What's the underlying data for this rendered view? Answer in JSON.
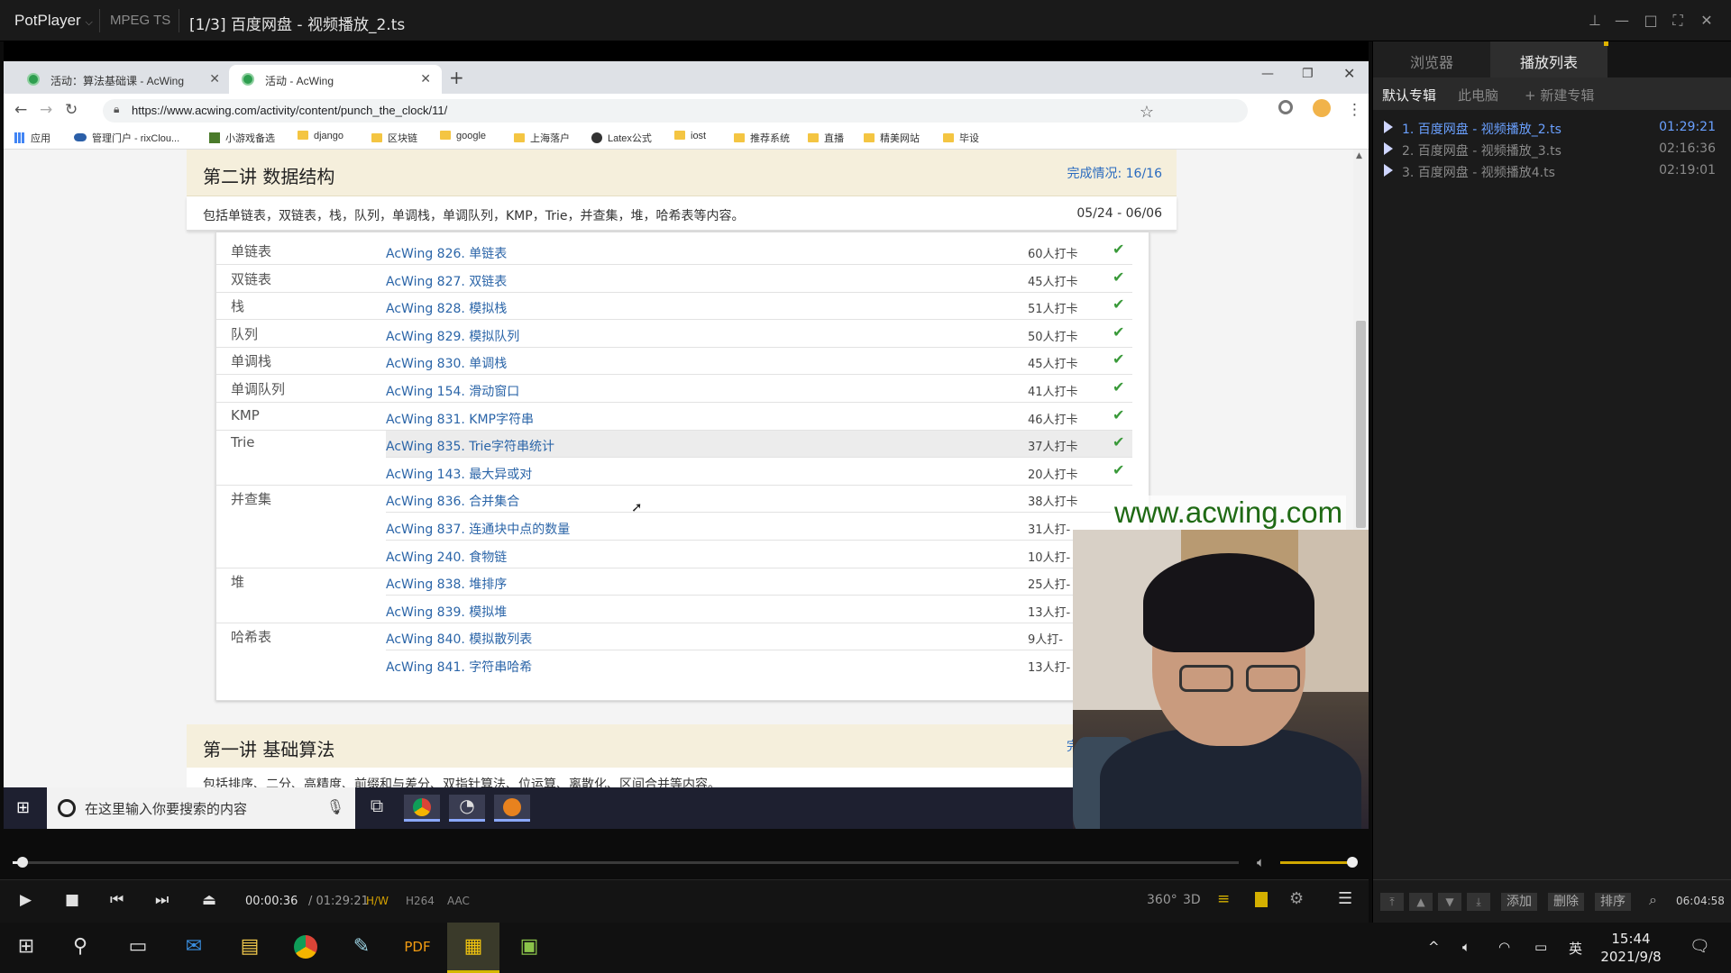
{
  "potplayer": {
    "brand": "PotPlayer",
    "format": "MPEG TS",
    "file_title": "[1/3] 百度网盘 - 视频播放_2.ts"
  },
  "chrome": {
    "tabs": [
      {
        "label": "活动：算法基础课 - AcWing",
        "active": false
      },
      {
        "label": "活动 - AcWing",
        "active": true
      }
    ],
    "new_tab": "+",
    "url": "https://www.acwing.com/activity/content/punch_the_clock/11/",
    "bookmarks": [
      {
        "label": "应用",
        "icon": "apps-icon"
      },
      {
        "label": "管理门户 - rixClou...",
        "icon": "cloud-icon"
      },
      {
        "label": "小游戏备选",
        "icon": "grid-icon"
      },
      {
        "label": "django",
        "icon": "folder-icon"
      },
      {
        "label": "区块链",
        "icon": "folder-icon"
      },
      {
        "label": "google",
        "icon": "folder-icon"
      },
      {
        "label": "上海落户",
        "icon": "folder-icon"
      },
      {
        "label": "Latex公式",
        "icon": "globe-icon"
      },
      {
        "label": "iost",
        "icon": "folder-icon"
      },
      {
        "label": "推荐系统",
        "icon": "folder-icon"
      },
      {
        "label": "直播",
        "icon": "folder-icon"
      },
      {
        "label": "精美网站",
        "icon": "folder-icon"
      },
      {
        "label": "毕设",
        "icon": "folder-icon"
      }
    ]
  },
  "course": {
    "section2": {
      "title": "第二讲 数据结构",
      "progress_label": "完成情况:  16/16",
      "description": "包括单链表，双链表，栈，队列，单调栈，单调队列，KMP，Trie，并查集，堆，哈希表等内容。",
      "dates": "05/24 - 06/06",
      "rows": [
        {
          "category": "单链表",
          "problem": "AcWing 826. 单链表",
          "count": "60人打卡",
          "done": true
        },
        {
          "category": "双链表",
          "problem": "AcWing 827. 双链表",
          "count": "45人打卡",
          "done": true
        },
        {
          "category": "栈",
          "problem": "AcWing 828. 模拟栈",
          "count": "51人打卡",
          "done": true
        },
        {
          "category": "队列",
          "problem": "AcWing 829. 模拟队列",
          "count": "50人打卡",
          "done": true
        },
        {
          "category": "单调栈",
          "problem": "AcWing 830. 单调栈",
          "count": "45人打卡",
          "done": true
        },
        {
          "category": "单调队列",
          "problem": "AcWing 154. 滑动窗口",
          "count": "41人打卡",
          "done": true
        },
        {
          "category": "KMP",
          "problem": "AcWing 831. KMP字符串",
          "count": "46人打卡",
          "done": true
        },
        {
          "category": "Trie",
          "problem": "AcWing 835. Trie字符串统计",
          "count": "37人打卡",
          "done": true
        },
        {
          "category": "",
          "problem": "AcWing 143. 最大异或对",
          "count": "20人打卡",
          "done": true
        },
        {
          "category": "并查集",
          "problem": "AcWing 836. 合并集合",
          "count": "38人打卡",
          "done": false
        },
        {
          "category": "",
          "problem": "AcWing 837. 连通块中点的数量",
          "count": "31人打-",
          "done": false
        },
        {
          "category": "",
          "problem": "AcWing 240. 食物链",
          "count": "10人打-",
          "done": false
        },
        {
          "category": "堆",
          "problem": "AcWing 838. 堆排序",
          "count": "25人打-",
          "done": false
        },
        {
          "category": "",
          "problem": "AcWing 839. 模拟堆",
          "count": "13人打-",
          "done": false
        },
        {
          "category": "哈希表",
          "problem": "AcWing 840. 模拟散列表",
          "count": "9人打-",
          "done": false
        },
        {
          "category": "",
          "problem": "AcWing 841. 字符串哈希",
          "count": "13人打-",
          "done": false
        }
      ]
    },
    "section1": {
      "title": "第一讲 基础算法",
      "progress_label": "完",
      "description": "包括排序、二分、高精度、前缀和与差分、双指针算法、位运算、离散化、区间合并等内容。"
    }
  },
  "inner_taskbar": {
    "search_placeholder": "在这里输入你要搜索的内容"
  },
  "watermark": "www.acwing.com",
  "controls": {
    "current_time": "00:00:36",
    "total_time": "/ 01:29:21",
    "hw": "H/W",
    "codec": "H264",
    "audio": "AAC",
    "seek_fraction": 0.0067,
    "volume_fraction": 1.0,
    "r360": "360°",
    "r3d": "3D"
  },
  "panel": {
    "tabs": [
      "浏览器",
      "播放列表"
    ],
    "subtabs": [
      "默认专辑",
      "此电脑",
      "+ 新建专辑"
    ],
    "playlist": [
      {
        "title": "1. 百度网盘 - 视频播放_2.ts",
        "duration": "01:29:21",
        "active": true
      },
      {
        "title": "2. 百度网盘 - 视频播放_3.ts",
        "duration": "02:16:36",
        "active": false
      },
      {
        "title": "3. 百度网盘 - 视频播放4.ts",
        "duration": "02:19:01",
        "active": false
      }
    ],
    "footer": {
      "add": "添加",
      "delete": "删除",
      "sort": "排序",
      "total": "06:04:58"
    }
  },
  "host_taskbar": {
    "ime": "英",
    "time": "15:44",
    "date": "2021/9/8"
  }
}
